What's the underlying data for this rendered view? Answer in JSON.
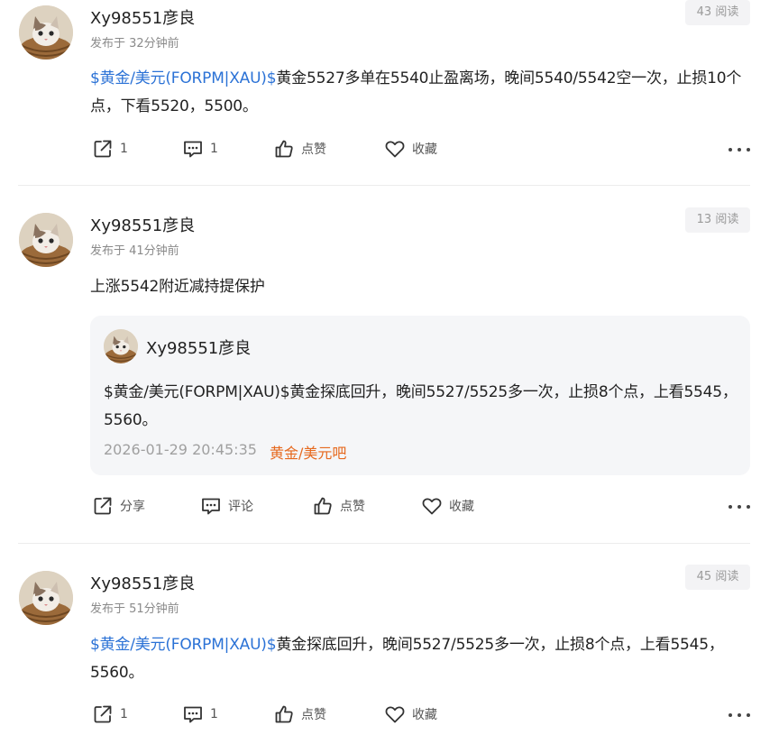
{
  "colors": {
    "link": "#2b72d6",
    "bar_link": "#e6691e",
    "muted": "#8a8a8a",
    "card_bg": "#f5f6f8"
  },
  "posts": [
    {
      "username": "Xy98551彦良",
      "time": "发布于 32分钟前",
      "reads": "43 阅读",
      "content_link": "$黄金/美元(FORPM|XAU)$",
      "content_text": "黄金5527多单在5540止盈离场，晚间5540/5542空一次，止损10个点，下看5520，5500。",
      "actions": {
        "share": "1",
        "comment": "1",
        "like": "点赞",
        "collect": "收藏"
      }
    },
    {
      "username": "Xy98551彦良",
      "time": "发布于 41分钟前",
      "reads": "13 阅读",
      "content_text": "上涨5542附近减持提保护",
      "quote": {
        "username": "Xy98551彦良",
        "content_link": "$黄金/美元(FORPM|XAU)$",
        "content_text": "黄金探底回升，晚间5527/5525多一次，止损8个点，上看5545，5560。",
        "date": "2026-01-29 20:45:35",
        "bar": "黄金/美元吧"
      },
      "actions": {
        "share": "分享",
        "comment": "评论",
        "like": "点赞",
        "collect": "收藏"
      }
    },
    {
      "username": "Xy98551彦良",
      "time": "发布于 51分钟前",
      "reads": "45 阅读",
      "content_link": "$黄金/美元(FORPM|XAU)$",
      "content_text": "黄金探底回升，晚间5527/5525多一次，止损8个点，上看5545，5560。",
      "actions": {
        "share": "1",
        "comment": "1",
        "like": "点赞",
        "collect": "收藏"
      }
    }
  ]
}
